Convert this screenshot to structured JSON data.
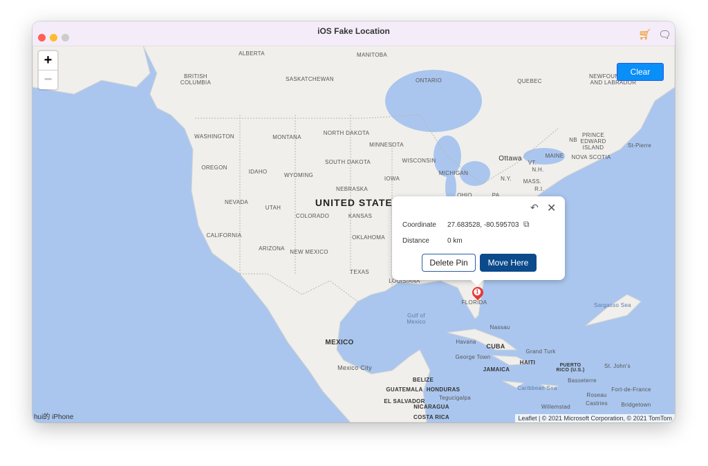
{
  "window": {
    "title": "iOS Fake Location",
    "icons": [
      "cart-icon",
      "chat-icon"
    ]
  },
  "map": {
    "zoom_in": "+",
    "zoom_out": "−",
    "clear_label": "Clear",
    "device": "hui的 iPhone",
    "attribution_link": "Leaflet",
    "attribution": " | © 2021 Microsoft Corporation, © 2021 TomTom",
    "country": "UNITED STATES",
    "country2": "MEXICO",
    "labels": [
      "ALBERTA",
      "MANITOBA",
      "BRITISH COLUMBIA",
      "SASKATCHEWAN",
      "ONTARIO",
      "QUEBEC",
      "NEWFOUNDLAND AND LABRADOR",
      "WASHINGTON",
      "MONTANA",
      "NORTH DAKOTA",
      "MINNESOTA",
      "OREGON",
      "IDAHO",
      "WYOMING",
      "SOUTH DAKOTA",
      "WISCONSIN",
      "MICHIGAN",
      "NEBRASKA",
      "IOWA",
      "NEVADA",
      "UTAH",
      "COLORADO",
      "KANSAS",
      "CALIFORNIA",
      "ARIZONA",
      "NEW MEXICO",
      "OKLAHOMA",
      "TEXAS",
      "LOUISIANA",
      "FLORIDA",
      "OHIO",
      "PA",
      "N.Y.",
      "MASS.",
      "R.I.",
      "VT.",
      "N.H.",
      "MAINE",
      "NB",
      "PRINCE EDWARD ISLAND",
      "NOVA SCOTIA",
      "St-Pierre",
      "Ottawa",
      "Nassau",
      "Havana",
      "CUBA",
      "George Town",
      "HAITI",
      "JAMAICA",
      "Grand Turk",
      "PUERTO RICO (U.S.)",
      "St. John's",
      "Basseterre",
      "Fort-de-France",
      "Roseau",
      "Castries",
      "Bridgetown",
      "Willemstad",
      "Mexico City",
      "BELIZE",
      "GUATEMALA",
      "HONDURAS",
      "Tegucigalpa",
      "EL SALVADOR",
      "NICARAGUA",
      "COSTA RICA"
    ],
    "seas": [
      "Gulf of Mexico",
      "Sargasso Sea",
      "Caribbean Sea"
    ]
  },
  "popup": {
    "coordinate_label": "Coordinate",
    "coordinate_value": "27.683528, -80.595703",
    "distance_label": "Distance",
    "distance_value": "0 km",
    "delete_label": "Delete Pin",
    "move_label": "Move Here",
    "pin_number": "1"
  },
  "colors": {
    "water": "#aac6ee",
    "land": "#f0efec",
    "accent": "#0a8ef8",
    "move_button": "#0b4a8b",
    "pin": "#e53935"
  }
}
